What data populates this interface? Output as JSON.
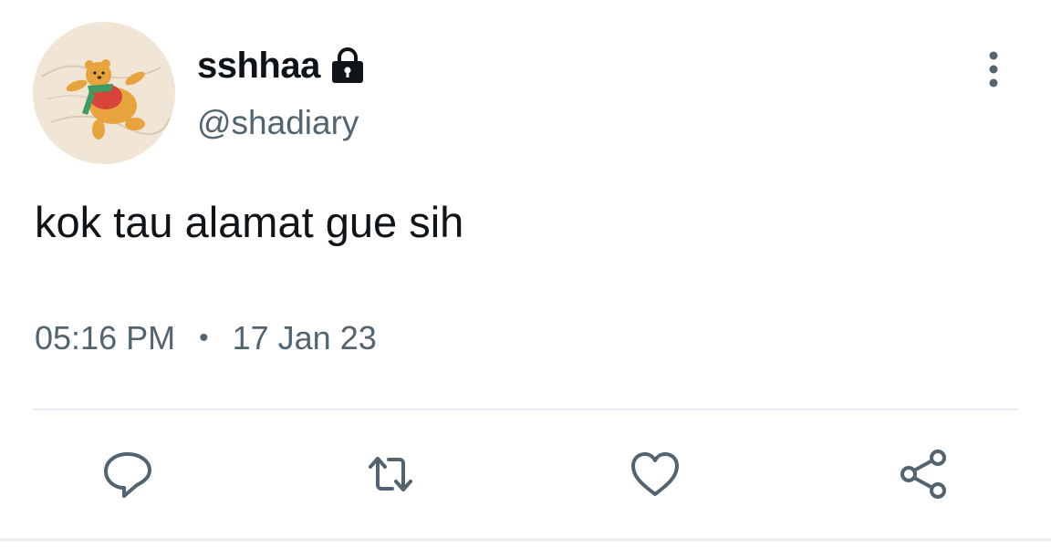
{
  "tweet": {
    "display_name": "sshhaa",
    "handle": "@shadiary",
    "text": "kok tau alamat gue sih",
    "time": "05:16 PM",
    "separator": "•",
    "date": "17 Jan 23",
    "protected_icon": "lock-icon",
    "avatar_icon": "profile-avatar"
  },
  "actions": {
    "reply_icon": "reply-icon",
    "retweet_icon": "retweet-icon",
    "like_icon": "heart-icon",
    "share_icon": "share-icon",
    "more_icon": "more-options-icon"
  },
  "colors": {
    "text_primary": "#0f1419",
    "text_secondary": "#536471",
    "divider": "#e6ecf0"
  }
}
